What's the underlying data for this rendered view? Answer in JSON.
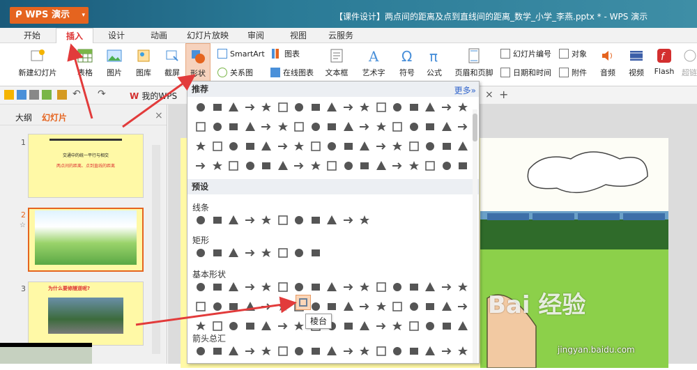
{
  "app": {
    "name": "WPS 演示",
    "title": "【课件设计】两点间的距离及点到直线间的距离_数学_小学_李燕.pptx * - WPS 演示"
  },
  "tabs": [
    "开始",
    "插入",
    "设计",
    "动画",
    "幻灯片放映",
    "审阅",
    "视图",
    "云服务"
  ],
  "active_tab": "插入",
  "ribbon": {
    "new_slide": "新建幻灯片",
    "table": "表格",
    "picture": "图片",
    "gallery": "图库",
    "screenshot": "截屏",
    "shapes": "形状",
    "smartart": "SmartArt",
    "chart": "图表",
    "relation": "关系图",
    "online_chart": "在线图表",
    "textbox": "文本框",
    "wordart": "艺术字",
    "symbol": "符号",
    "formula": "公式",
    "header_footer": "页眉和页脚",
    "slide_number": "幻灯片编号",
    "object": "对象",
    "datetime": "日期和时间",
    "attachment": "附件",
    "audio": "音频",
    "video": "视频",
    "flash": "Flash",
    "hyperlink": "超链"
  },
  "qat": {
    "my_wps": "我的WPS",
    "close": "×",
    "add": "+"
  },
  "left_pane": {
    "outline": "大纲",
    "slides": "幻灯片",
    "close": "×",
    "slides_list": [
      {
        "num": "1",
        "line1": "交通中的统一平行与相交",
        "line2": "两点间的距离、点到直线的距离"
      },
      {
        "num": "2"
      },
      {
        "num": "3",
        "title": "为什么要修隧道呢?"
      }
    ]
  },
  "dropdown": {
    "recommend": "推荐",
    "more": "更多»",
    "preset": "预设",
    "lines": "线条",
    "rect": "矩形",
    "basic": "基本形状",
    "arrows": "箭头总汇",
    "tooltip": "棱台"
  },
  "watermark": {
    "text": "Bai 经验",
    "url": "jingyan.baidu.com"
  },
  "colors": {
    "accent": "#e5641f",
    "link": "#3366cc",
    "slide_bg": "#fff9a6",
    "arrow": "#e23b3b"
  }
}
